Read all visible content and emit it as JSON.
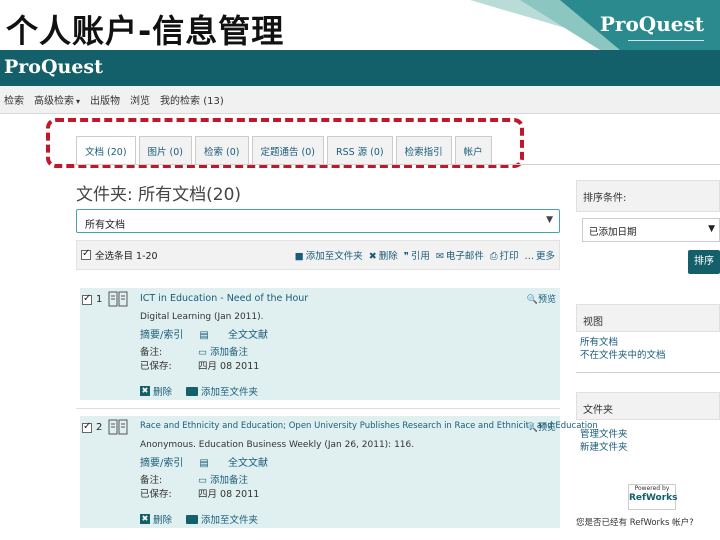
{
  "slide": {
    "title": "个人账户-信息管理",
    "logo": "ProQuest"
  },
  "app": {
    "logo": "ProQuest",
    "nav": [
      {
        "label": "检索"
      },
      {
        "label": "高级检索",
        "dropdown": true
      },
      {
        "label": "出版物"
      },
      {
        "label": "浏览"
      },
      {
        "label": "我的检索 (13)"
      }
    ]
  },
  "tabs": [
    {
      "label": "文档 (20)",
      "active": true
    },
    {
      "label": "图片 (0)"
    },
    {
      "label": "检索 (0)"
    },
    {
      "label": "定题通告 (0)"
    },
    {
      "label": "RSS 源 (0)"
    },
    {
      "label": "检索指引"
    },
    {
      "label": "帐户"
    }
  ],
  "folder": {
    "title": "文件夹: 所有文档(20)",
    "select_value": "所有文档"
  },
  "toolbar": {
    "select_all": "全选条目 1-20",
    "actions": [
      {
        "icon": "folder-add-icon",
        "glyph": "■",
        "label": "添加至文件夹"
      },
      {
        "icon": "delete-icon",
        "glyph": "✖",
        "label": "删除"
      },
      {
        "icon": "quote-icon",
        "glyph": "❞",
        "label": "引用"
      },
      {
        "icon": "email-icon",
        "glyph": "✉",
        "label": "电子邮件"
      },
      {
        "icon": "print-icon",
        "glyph": "⎙",
        "label": "打印"
      },
      {
        "icon": "more-icon",
        "glyph": "…",
        "label": "更多"
      }
    ]
  },
  "results": [
    {
      "num": "1",
      "title": "ICT in Education - Need of the Hour",
      "source": "Digital Learning (Jan 2011).",
      "links": [
        "摘要/索引",
        "全文文献"
      ],
      "note_label": "备注:",
      "note_value": "添加备注",
      "saved_label": "已保存:",
      "saved_value": "四月 08 2011",
      "delete": "删除",
      "add_folder": "添加至文件夹",
      "preview": "预览"
    },
    {
      "num": "2",
      "title": "Race and Ethnicity and Education; Open University Publishes Research in Race and Ethnicity and Education",
      "source": "Anonymous. Education Business Weekly (Jan 26, 2011): 116.",
      "links": [
        "摘要/索引",
        "全文文献"
      ],
      "note_label": "备注:",
      "note_value": "添加备注",
      "saved_label": "已保存:",
      "saved_value": "四月 08 2011",
      "delete": "删除",
      "add_folder": "添加至文件夹",
      "preview": "预览"
    }
  ],
  "sidebar": {
    "sort_label": "排序条件:",
    "sort_value": "已添加日期",
    "sort_button": "排序",
    "view_label": "视图",
    "view_items": [
      "所有文档",
      "不在文件夹中的文档"
    ],
    "folders_label": "文件夹",
    "folder_items": [
      "管理文件夹",
      "新建文件夹"
    ],
    "refworks_powered": "Powered by",
    "refworks_name": "RefWorks",
    "refworks_caption": "您是否已经有 RefWorks 帐户?"
  }
}
